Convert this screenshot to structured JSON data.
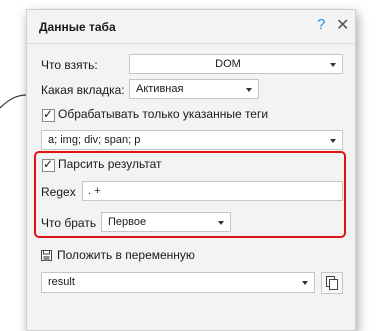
{
  "dialog": {
    "title": "Данные таба",
    "help_symbol": "?",
    "close_symbol": "✕"
  },
  "what_to_take": {
    "label": "Что взять:",
    "value": "DOM"
  },
  "which_tab": {
    "label": "Какая вкладка:",
    "value": "Активная"
  },
  "only_tags": {
    "label": "Обрабатывать только указанные теги",
    "checked": true,
    "value": "a; img; div; span; p"
  },
  "parse_result": {
    "label": "Парсить результат",
    "checked": true
  },
  "regex": {
    "label": "Regex",
    "value": ". +"
  },
  "what_take": {
    "label": "Что брать",
    "value": "Первое"
  },
  "save_to_var": {
    "label": "Положить в переменную",
    "value": "result"
  },
  "colors": {
    "highlight": "#e01414",
    "accent": "#2f8cd8"
  }
}
